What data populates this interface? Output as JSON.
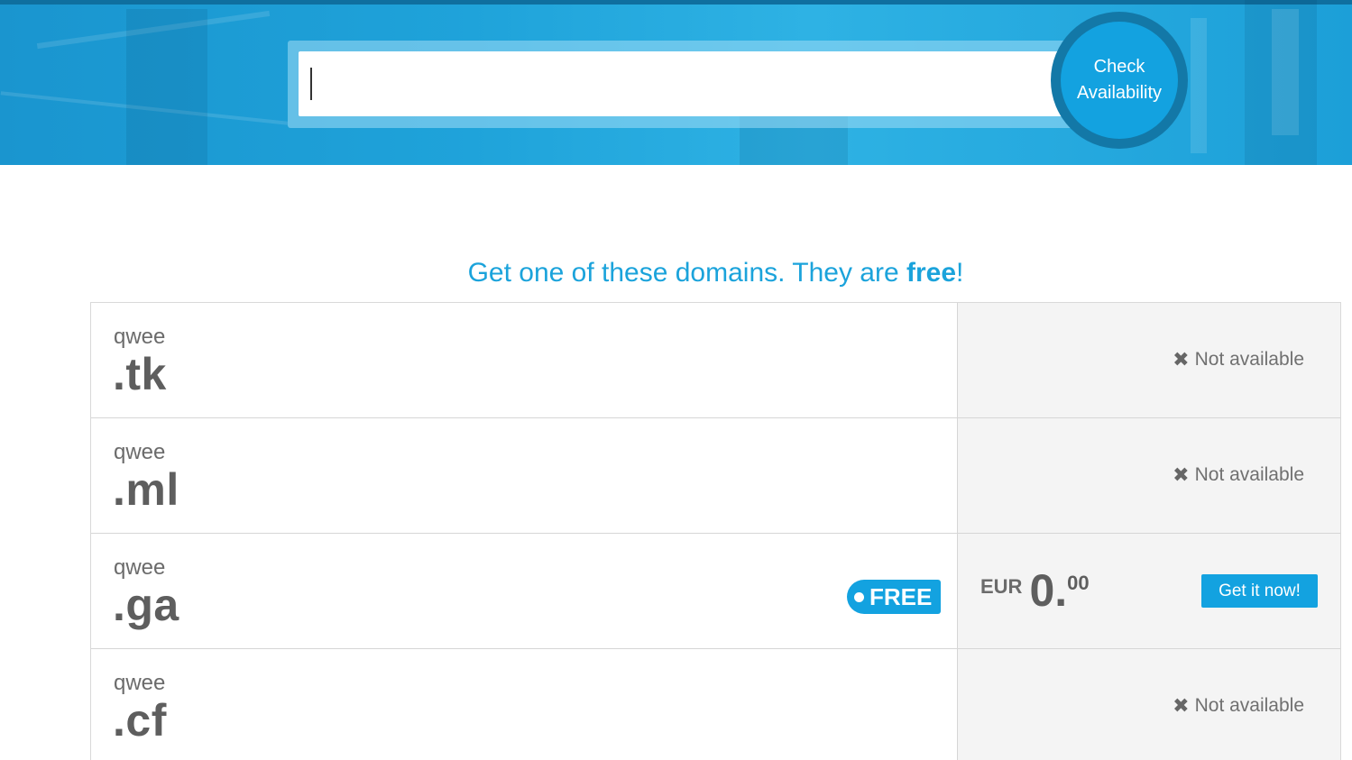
{
  "search": {
    "value": "",
    "placeholder": "",
    "button_line1": "Check",
    "button_line2": "Availability"
  },
  "heading": {
    "prefix": "Get one of these domains. They are ",
    "bold": "free",
    "suffix": "!"
  },
  "domains": [
    {
      "name": "qwee",
      "tld": ".tk",
      "status": "Not available"
    },
    {
      "name": "qwee",
      "tld": ".ml",
      "status": "Not available"
    },
    {
      "name": "qwee",
      "tld": ".ga",
      "badge": "FREE",
      "currency": "EUR",
      "price_int": "0.",
      "price_dec": "00",
      "action": "Get it now!"
    },
    {
      "name": "qwee",
      "tld": ".cf",
      "status": "Not available"
    }
  ],
  "colors": {
    "accent": "#13a2e0",
    "hero": "#1fa3da",
    "text": "#6b6b6b"
  },
  "icons": {
    "not_available": "close-icon",
    "free": "dot-icon"
  }
}
